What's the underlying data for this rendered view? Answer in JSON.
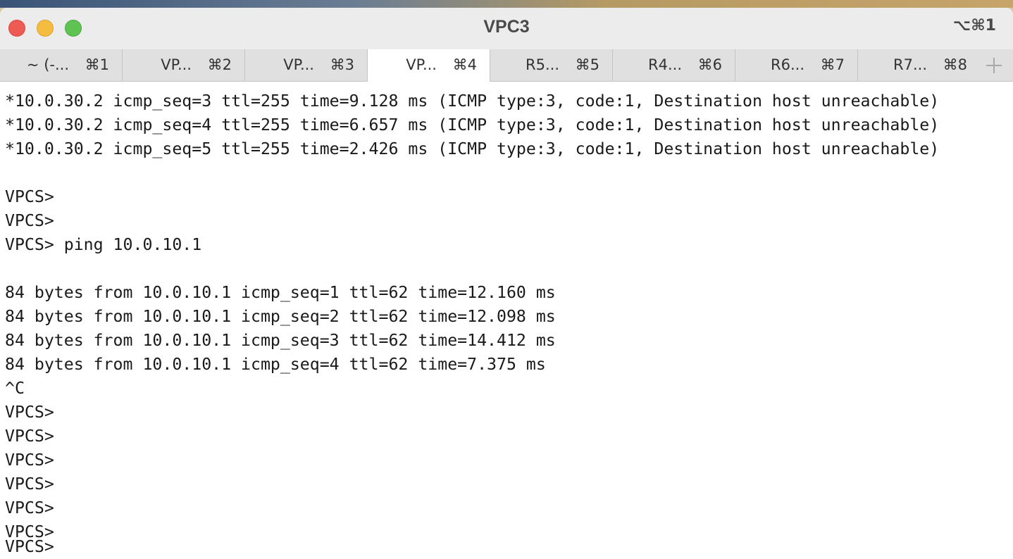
{
  "window": {
    "title": "VPC3",
    "shortcut": "⌥⌘1"
  },
  "tabs": [
    {
      "label": "~ (-...",
      "key": "⌘1",
      "active": false
    },
    {
      "label": "VP...",
      "key": "⌘2",
      "active": false
    },
    {
      "label": "VP...",
      "key": "⌘3",
      "active": false
    },
    {
      "label": "VP...",
      "key": "⌘4",
      "active": true
    },
    {
      "label": "R5...",
      "key": "⌘5",
      "active": false
    },
    {
      "label": "R4...",
      "key": "⌘6",
      "active": false
    },
    {
      "label": "R6...",
      "key": "⌘7",
      "active": false
    },
    {
      "label": "R7...",
      "key": "⌘8",
      "active": false
    }
  ],
  "new_tab_icon": "plus-icon",
  "terminal": {
    "lines": [
      "*10.0.30.2 icmp_seq=3 ttl=255 time=9.128 ms (ICMP type:3, code:1, Destination host unreachable)",
      "*10.0.30.2 icmp_seq=4 ttl=255 time=6.657 ms (ICMP type:3, code:1, Destination host unreachable)",
      "*10.0.30.2 icmp_seq=5 ttl=255 time=2.426 ms (ICMP type:3, code:1, Destination host unreachable)",
      "",
      "VPCS>",
      "VPCS>",
      "VPCS> ping 10.0.10.1",
      "",
      "84 bytes from 10.0.10.1 icmp_seq=1 ttl=62 time=12.160 ms",
      "84 bytes from 10.0.10.1 icmp_seq=2 ttl=62 time=12.098 ms",
      "84 bytes from 10.0.10.1 icmp_seq=3 ttl=62 time=14.412 ms",
      "84 bytes from 10.0.10.1 icmp_seq=4 ttl=62 time=7.375 ms",
      "^C",
      "VPCS>",
      "VPCS>",
      "VPCS>",
      "VPCS>",
      "VPCS>",
      "VPCS>",
      "VPCS>"
    ]
  },
  "colors": {
    "close": "#ee5b52",
    "minimize": "#f5bd3f",
    "maximize": "#5fc354",
    "active_tab": "#ffffff",
    "inactive_tab": "#e0e0e0"
  }
}
